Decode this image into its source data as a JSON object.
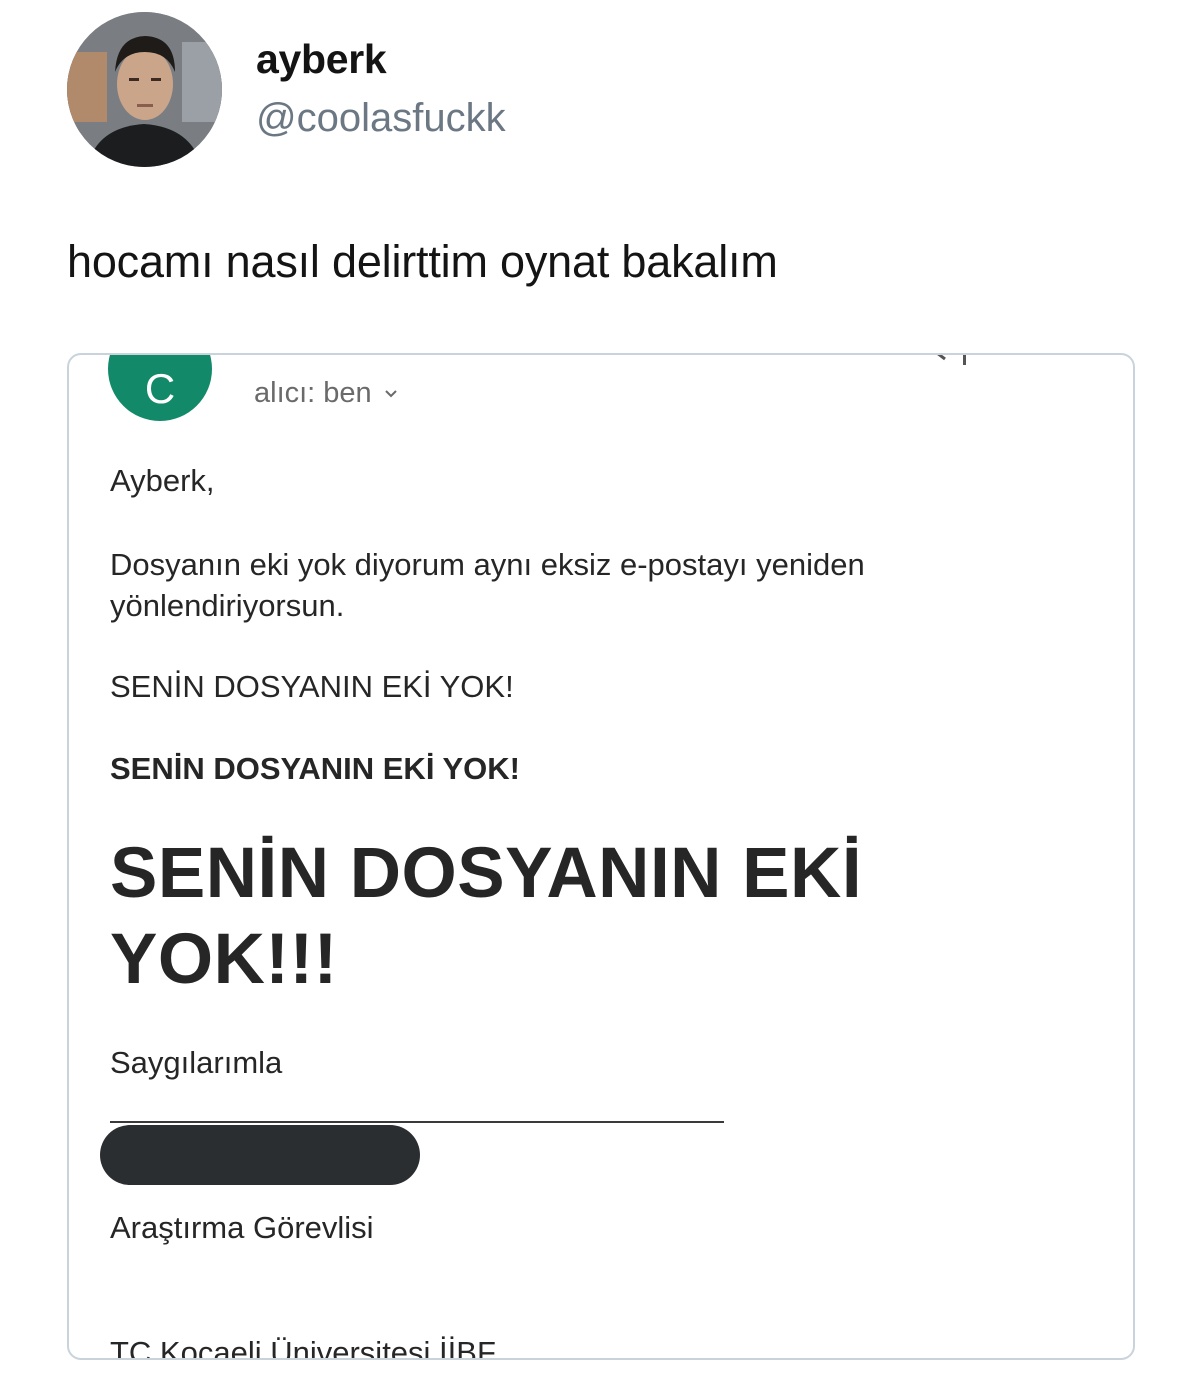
{
  "tweet": {
    "display_name": "ayberk",
    "handle": "@coolasfuckk",
    "text": "hocamı nasıl delirttim oynat bakalım"
  },
  "email": {
    "sender_initial": "C",
    "sender_avatar_color": "#128a6a",
    "recipient_label": "alıcı: ben",
    "greeting": "Ayberk,",
    "body": "Dosyanın eki yok diyorum aynı eksiz e-postayı yeniden yönlendiriyorsun.",
    "shout_regular": "SENİN DOSYANIN EKİ YOK!",
    "shout_bold": "SENİN DOSYANIN EKİ YOK!",
    "shout_large": "SENİN DOSYANIN EKİ YOK!!!",
    "closing": "Saygılarımla",
    "job_title": "Araştırma Görevlisi",
    "institution": "TC Kocaeli Üniversitesi İİBF"
  },
  "colors": {
    "handle": "#6b7884",
    "media_border": "#c9d3dc",
    "redaction": "#2b2e31"
  },
  "icons": {
    "recipient_toggle": "chevron-down-icon"
  }
}
